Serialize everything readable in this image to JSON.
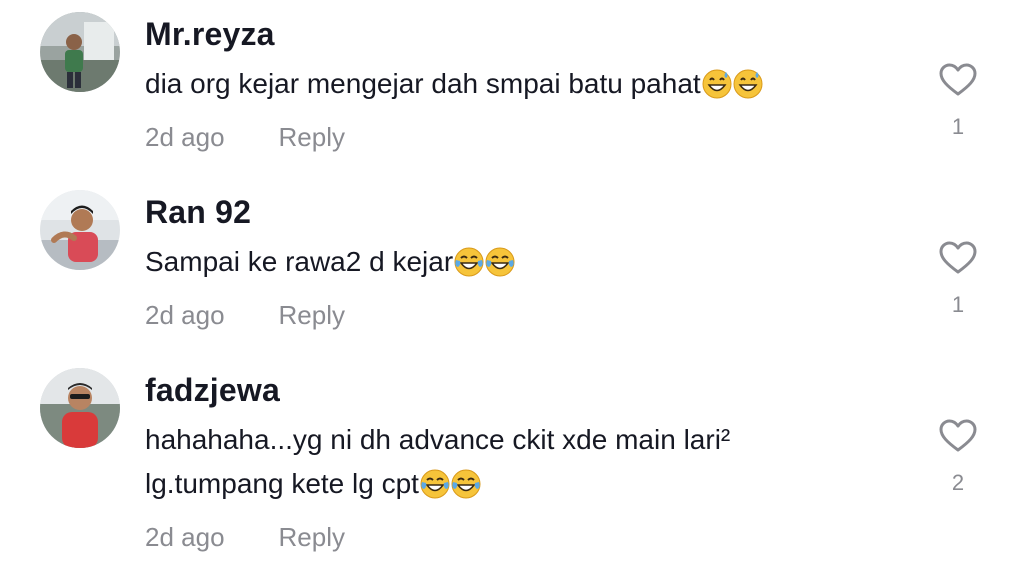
{
  "comments": [
    {
      "username": "Mr.reyza",
      "text": "dia org kejar mengejar dah smpai batu pahat",
      "emoji": [
        "😅",
        "😅"
      ],
      "time": "2d ago",
      "reply": "Reply",
      "likes": "1"
    },
    {
      "username": "Ran 92",
      "text": "Sampai ke rawa2 d kejar",
      "emoji": [
        "😂",
        "😂"
      ],
      "time": "2d ago",
      "reply": "Reply",
      "likes": "1"
    },
    {
      "username": "fadzjewa",
      "text_line1": "hahahaha...yg ni dh advance ckit xde main lari²",
      "text_line2": "lg.tumpang kete lg cpt",
      "emoji": [
        "😂",
        "😂"
      ],
      "time": "2d ago",
      "reply": "Reply",
      "likes": "2"
    }
  ],
  "icons": {
    "like": "heart-outline-icon",
    "avatar": "user-avatar"
  },
  "colors": {
    "text": "#161823",
    "secondary": "#8a8b91",
    "heart": "#8a8b91"
  }
}
